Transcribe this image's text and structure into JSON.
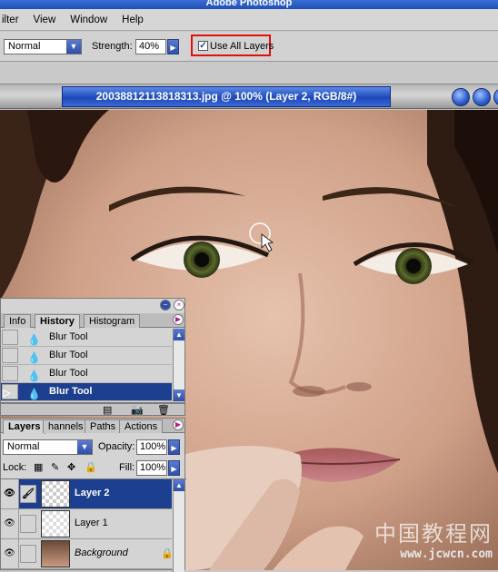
{
  "app": {
    "title": "Adobe Photoshop"
  },
  "menu": [
    "ilter",
    "View",
    "Window",
    "Help"
  ],
  "options": {
    "mode": "Normal",
    "strength_label": "Strength:",
    "strength_value": "40%",
    "use_all_layers_label": "Use All Layers",
    "use_all_layers_checked": true
  },
  "document": {
    "title": "20038812113818313.jpg @ 100% (Layer 2, RGB/8#)"
  },
  "history_panel": {
    "tabs": [
      "Info",
      "History",
      "Histogram"
    ],
    "active_tab": "History",
    "items": [
      "Blur Tool",
      "Blur Tool",
      "Blur Tool",
      "Blur Tool"
    ],
    "selected_index": 3
  },
  "layers_panel": {
    "tabs": [
      "Layers",
      "hannels",
      "Paths",
      "Actions"
    ],
    "active_tab": "Layers",
    "blend_mode": "Normal",
    "opacity_label": "Opacity:",
    "opacity_value": "100%",
    "lock_label": "Lock:",
    "fill_label": "Fill:",
    "fill_value": "100%",
    "layers": [
      {
        "name": "Layer 2",
        "selected": true
      },
      {
        "name": "Layer 1",
        "selected": false
      },
      {
        "name": "Background",
        "selected": false,
        "locked": true
      }
    ]
  },
  "watermark": {
    "line1": "中国教程网",
    "line2": "www.jcwcn.com"
  },
  "colors": {
    "highlight_box": "#e01010",
    "selection": "#1d3f8f",
    "accent_blue": "#2f4fa8"
  }
}
